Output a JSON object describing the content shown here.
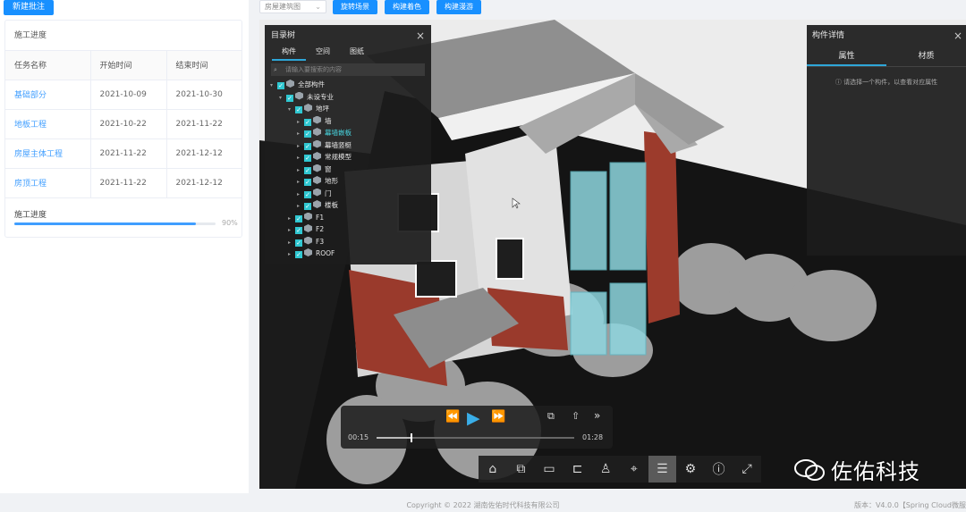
{
  "left_panel": {
    "new_button": "新建批注",
    "card_title": "施工进度",
    "columns": [
      "任务名称",
      "开始时间",
      "结束时间"
    ],
    "rows": [
      {
        "name": "基础部分",
        "start": "2021-10-09",
        "end": "2021-10-30"
      },
      {
        "name": "地板工程",
        "start": "2021-10-22",
        "end": "2021-11-22"
      },
      {
        "name": "房屋主体工程",
        "start": "2021-11-22",
        "end": "2021-12-12"
      },
      {
        "name": "房顶工程",
        "start": "2021-11-22",
        "end": "2021-12-12"
      }
    ],
    "progress_label": "施工进度",
    "progress_percent": 90,
    "progress_text": "90%"
  },
  "toolbar": {
    "select_value": "房屋建筑图",
    "buttons": [
      "旋转场景",
      "构建着色",
      "构建漫游"
    ]
  },
  "tree_panel": {
    "title": "目录树",
    "tabs": [
      "构件",
      "空间",
      "图纸"
    ],
    "search_placeholder": "请输入要搜索的内容",
    "nodes": [
      {
        "label": "全部构件",
        "level": 0,
        "expanded": true
      },
      {
        "label": "未设专业",
        "level": 1,
        "expanded": true
      },
      {
        "label": "地坪",
        "level": 2,
        "expanded": true
      },
      {
        "label": "墙",
        "level": 3
      },
      {
        "label": "幕墙嵌板",
        "level": 3,
        "highlight": true
      },
      {
        "label": "幕墙竖梃",
        "level": 3
      },
      {
        "label": "常规模型",
        "level": 3
      },
      {
        "label": "窗",
        "level": 3
      },
      {
        "label": "地形",
        "level": 3
      },
      {
        "label": "门",
        "level": 3
      },
      {
        "label": "楼板",
        "level": 3
      },
      {
        "label": "F1",
        "level": 2
      },
      {
        "label": "F2",
        "level": 2
      },
      {
        "label": "F3",
        "level": 2
      },
      {
        "label": "ROOF",
        "level": 2
      }
    ]
  },
  "detail_panel": {
    "title": "构件详情",
    "tabs": [
      "属性",
      "材质"
    ],
    "hint": "请选择一个构件，以查看对应属性"
  },
  "player": {
    "current_time": "00:15",
    "total_time": "01:28",
    "progress": 0.17
  },
  "bottom_toolbar": {
    "icons": [
      "home-icon",
      "zoom-box-icon",
      "measure-icon",
      "section-icon",
      "person-icon",
      "locate-icon",
      "list-icon",
      "gear-icon",
      "info-icon",
      "fullscreen-icon"
    ],
    "glyphs": [
      "⌂",
      "⧉",
      "▭",
      "⊏",
      "♙",
      "⌖",
      "☰",
      "⚙",
      "ⓘ",
      "⤢"
    ]
  },
  "watermark": {
    "text": "佐佑科技"
  },
  "footer": {
    "copyright": "Copyright © 2022 湖南佐佑时代科技有限公司",
    "version": "版本：V4.0.0【Spring Cloud微服"
  }
}
